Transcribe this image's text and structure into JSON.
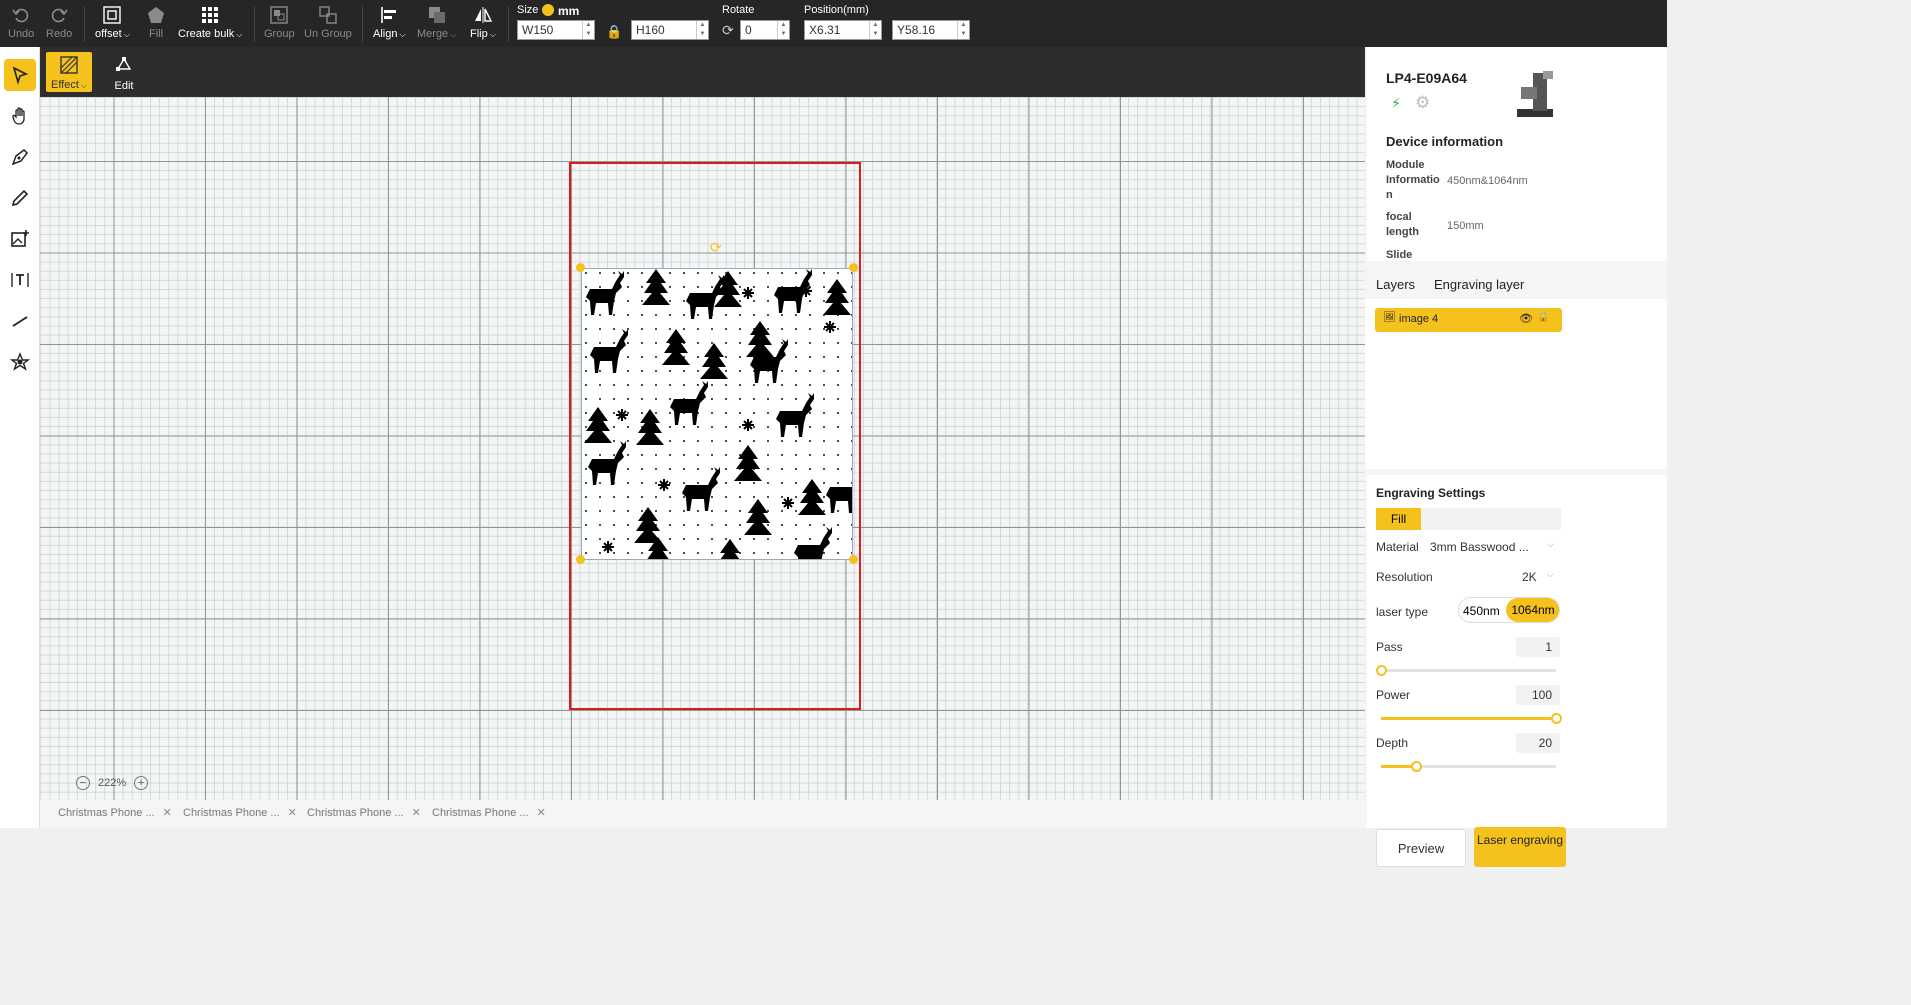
{
  "toolbar": {
    "undo": "Undo",
    "redo": "Redo",
    "offset": "offset",
    "fill": "Fill",
    "create_bulk": "Create bulk",
    "group": "Group",
    "ungroup": "Un Group",
    "align": "Align",
    "merge": "Merge",
    "flip": "Flip",
    "size_label": "Size",
    "size_unit": "mm",
    "width_prefix": "W",
    "width": "150",
    "height_prefix": "H",
    "height": "160",
    "rotate_label": "Rotate",
    "rotate": "0",
    "position_label": "Position(mm)",
    "x_prefix": "X",
    "x": "6.31",
    "y_prefix": "Y",
    "y": "58.16"
  },
  "subbar": {
    "effect": "Effect",
    "edit": "Edit"
  },
  "canvas": {
    "zoom": "222%"
  },
  "file_tabs": [
    "Christmas Phone ...",
    "Christmas Phone ...",
    "Christmas Phone ...",
    "Christmas Phone ..."
  ],
  "device": {
    "name": "LP4-E09A64",
    "info_title": "Device information",
    "module_label": "Module Informatio n",
    "module_value": "450nm&1064nm",
    "focal_label": "focal length",
    "focal_value": "150mm",
    "slide_label": "Slide"
  },
  "layers": {
    "tab_layers": "Layers",
    "tab_engraving": "Engraving layer",
    "item": "image 4"
  },
  "engraving": {
    "title": "Engraving Settings",
    "mode": "Fill",
    "material_label": "Material",
    "material": "3mm Basswood ...",
    "resolution_label": "Resolution",
    "resolution": "2K",
    "laser_label": "laser type",
    "laser_a": "450nm",
    "laser_b": "1064nm",
    "pass_label": "Pass",
    "pass": "1",
    "pass_fraction": 0,
    "power_label": "Power",
    "power": "100",
    "power_fraction": 1,
    "depth_label": "Depth",
    "depth": "20",
    "depth_fraction": 0.2,
    "preview": "Preview",
    "laser_button": "Laser engraving"
  },
  "colors": {
    "accent": "#f5c11c",
    "topbar": "#262626",
    "artboard": "#e01b1b"
  }
}
